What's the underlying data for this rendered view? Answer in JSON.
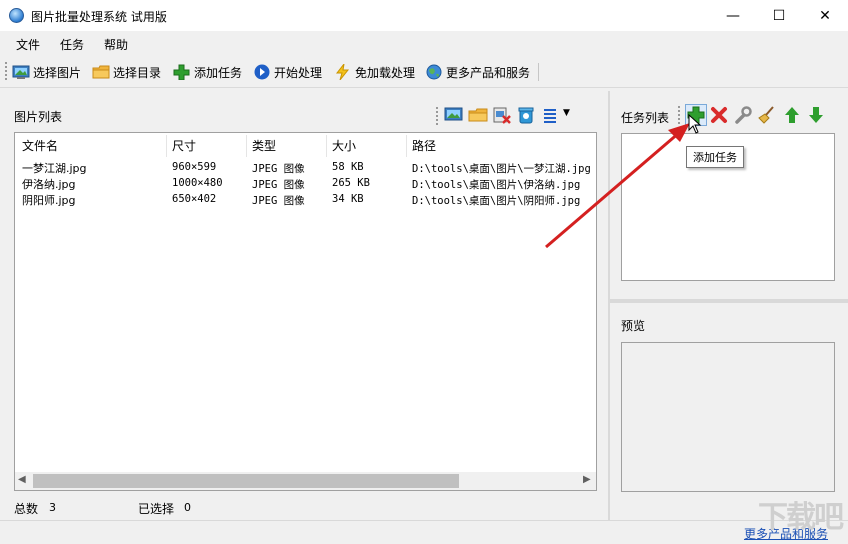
{
  "window": {
    "title": "图片批量处理系统 试用版",
    "controls": {
      "minimize": "—",
      "maximize": "☐",
      "close": "✕"
    }
  },
  "menu": [
    "文件",
    "任务",
    "帮助"
  ],
  "toolbar": {
    "select_image": "选择图片",
    "select_folder": "选择目录",
    "add_task": "添加任务",
    "start": "开始处理",
    "no_load": "免加载处理",
    "more_products": "更多产品和服务"
  },
  "image_list": {
    "title": "图片列表",
    "columns": [
      "文件名",
      "尺寸",
      "类型",
      "大小",
      "路径"
    ],
    "rows": [
      {
        "name": "一梦江湖.jpg",
        "size": "960×599",
        "type": "JPEG 图像",
        "filesize": "58 KB",
        "path": "D:\\tools\\桌面\\图片\\一梦江湖.jpg"
      },
      {
        "name": "伊洛纳.jpg",
        "size": "1000×480",
        "type": "JPEG 图像",
        "filesize": "265 KB",
        "path": "D:\\tools\\桌面\\图片\\伊洛纳.jpg"
      },
      {
        "name": "阴阳师.jpg",
        "size": "650×402",
        "type": "JPEG 图像",
        "filesize": "34 KB",
        "path": "D:\\tools\\桌面\\图片\\阴阳师.jpg"
      }
    ],
    "total_label": "总数",
    "total_value": "3",
    "selected_label": "已选择",
    "selected_value": "0"
  },
  "task_list": {
    "title": "任务列表",
    "tooltip": "添加任务"
  },
  "preview": {
    "title": "预览"
  },
  "status": {
    "link": "更多产品和服务"
  },
  "watermark": "下载吧",
  "colors": {
    "accent_green": "#2e9e2e",
    "delete_red": "#d92b2b",
    "arrow_red": "#d42020",
    "link_blue": "#1a4fb4"
  }
}
